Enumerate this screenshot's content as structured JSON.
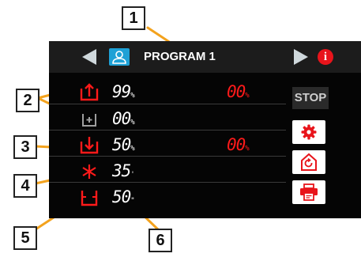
{
  "header": {
    "program_title": "PROGRAM 1",
    "user_icon": "user-icon",
    "info_icon": "info-icon",
    "info_glyph": "i"
  },
  "rows": [
    {
      "icon": "fill-up-icon",
      "value": "99",
      "unit": "%",
      "target": "00",
      "target_unit": "%"
    },
    {
      "icon": "plus-tank-icon",
      "value": "00",
      "unit": "%"
    },
    {
      "icon": "drain-down-icon",
      "value": "50",
      "unit": "%",
      "target": "00",
      "target_unit": "%"
    },
    {
      "icon": "cool-star-icon",
      "value": "35",
      "unit": "'"
    },
    {
      "icon": "tank-icon",
      "value": "50",
      "unit": "\""
    }
  ],
  "side_buttons": {
    "stop_label": "STOP",
    "settings_icon": "gear-icon",
    "cycle_icon": "cycle-house-icon",
    "print_icon": "printer-icon"
  },
  "callouts": [
    "1",
    "2",
    "3",
    "4",
    "5",
    "6"
  ],
  "colors": {
    "screen_bg": "#050505",
    "accent_red": "#ff1a1a",
    "user_blue": "#1ea1d6",
    "callout_line": "#f3a21d"
  }
}
